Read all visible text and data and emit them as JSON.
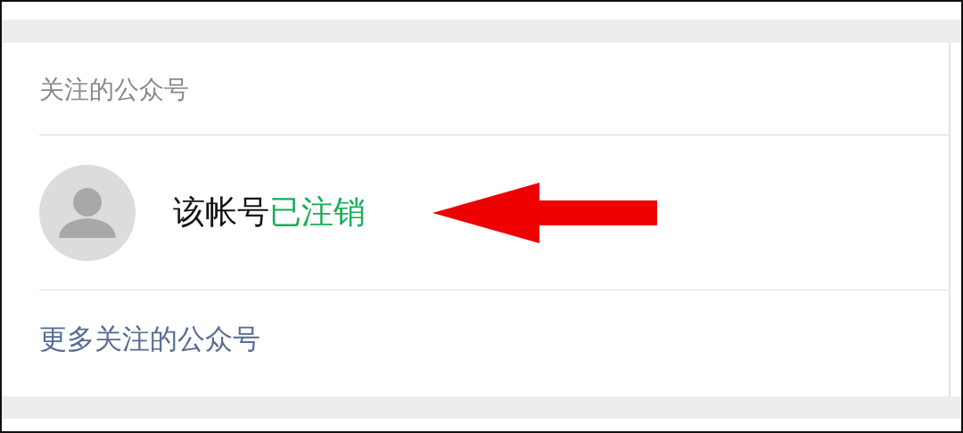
{
  "section": {
    "title": "关注的公众号"
  },
  "accounts": [
    {
      "name": "该帐号",
      "status": "已注销",
      "color": "#1aad5a"
    }
  ],
  "more_link": {
    "label": "更多关注的公众号"
  }
}
